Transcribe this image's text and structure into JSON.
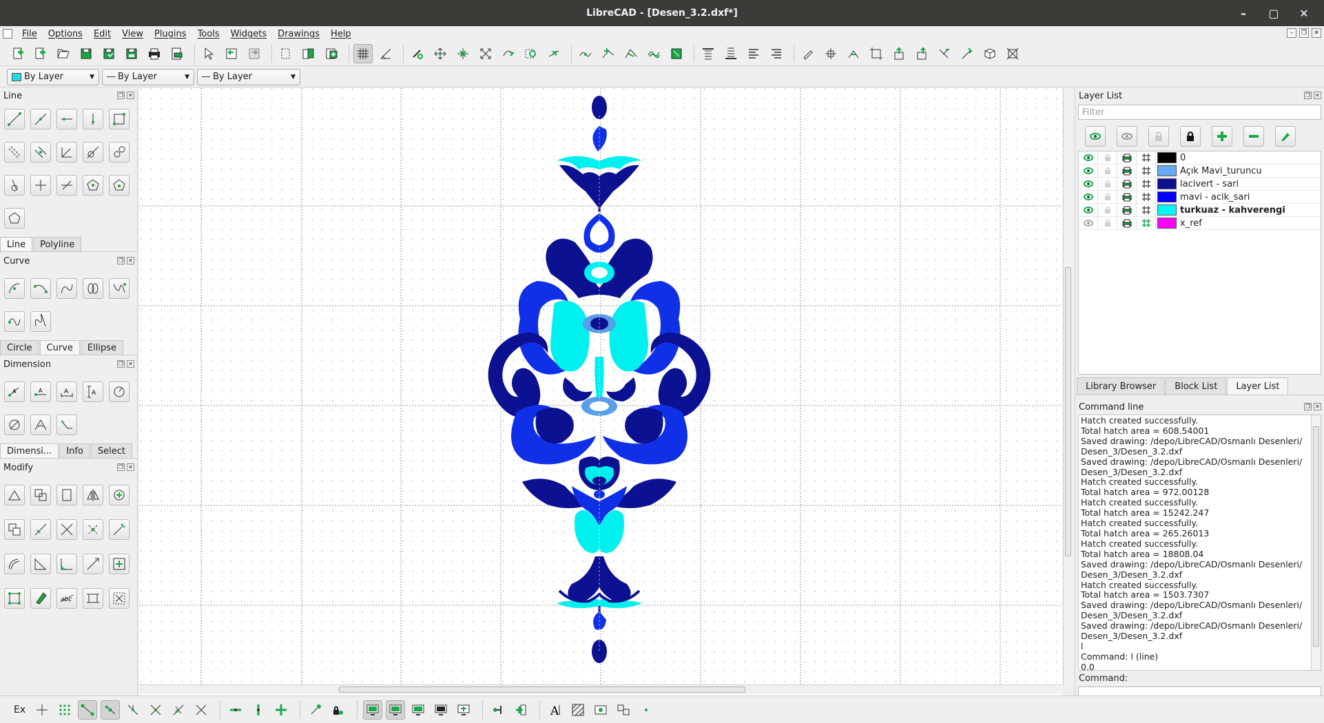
{
  "window": {
    "title": "LibreCAD - [Desen_3.2.dxf*]"
  },
  "menubar": [
    "File",
    "Options",
    "Edit",
    "View",
    "Plugins",
    "Tools",
    "Widgets",
    "Drawings",
    "Help"
  ],
  "properties": {
    "color": "By Layer",
    "linetype": "By Layer",
    "linewidth": "By Layer"
  },
  "left_panels": {
    "line": {
      "title": "Line",
      "tabs": [
        "Line",
        "Polyline"
      ]
    },
    "curve": {
      "title": "Curve",
      "tabs": [
        "Circle",
        "Curve",
        "Ellipse"
      ]
    },
    "dimension": {
      "title": "Dimension",
      "tabs": [
        "Dimensi...",
        "Info",
        "Select"
      ]
    },
    "modify": {
      "title": "Modify"
    }
  },
  "layer_list": {
    "title": "Layer List",
    "filter_placeholder": "Filter",
    "layers": [
      {
        "name": "0",
        "color": "#000000",
        "visible": true,
        "bold": false
      },
      {
        "name": "Açık Mavi_turuncu",
        "color": "#66aaf5",
        "visible": true,
        "bold": false
      },
      {
        "name": "lacivert - sari",
        "color": "#0b1190",
        "visible": true,
        "bold": false
      },
      {
        "name": "mavi - acik_sari",
        "color": "#0000ff",
        "visible": true,
        "bold": false
      },
      {
        "name": "turkuaz - kahverengi",
        "color": "#00f8f8",
        "visible": true,
        "bold": true
      },
      {
        "name": "x_ref",
        "color": "#ff00ff",
        "visible": false,
        "bold": false
      }
    ]
  },
  "right_tabs": [
    "Library Browser",
    "Block List",
    "Layer List"
  ],
  "command_line": {
    "title": "Command line",
    "lines": [
      "Hatch created successfully.",
      "Total hatch area =  608.54001",
      "Saved drawing: /depo/LibreCAD/Osmanlı Desenleri/",
      "Desen_3/Desen_3.2.dxf",
      "Saved drawing: /depo/LibreCAD/Osmanlı Desenleri/",
      "Desen_3/Desen_3.2.dxf",
      "Hatch created successfully.",
      "Total hatch area =  972.00128",
      "Hatch created successfully.",
      "Total hatch area =  15242.247",
      "Hatch created successfully.",
      "Total hatch area =  265.26013",
      "Hatch created successfully.",
      "Total hatch area =   18808.04",
      "Saved drawing: /depo/LibreCAD/Osmanlı Desenleri/",
      "Desen_3/Desen_3.2.dxf",
      "Hatch created successfully.",
      "Total hatch area =  1503.7307",
      "Saved drawing: /depo/LibreCAD/Osmanlı Desenleri/",
      "Desen_3/Desen_3.2.dxf",
      "Saved drawing: /depo/LibreCAD/Osmanlı Desenleri/",
      "Desen_3/Desen_3.2.dxf",
      "l",
      "Command: l (line)",
      "0,0"
    ],
    "input_label": "Command:"
  },
  "statusbar": {
    "snap_label": "Ex"
  },
  "colors": {
    "navy": "#0b1190",
    "blue": "#1030e8",
    "cyan": "#00f0f0",
    "light_blue": "#5a9ee6",
    "toolbar_green": "#1aa84a"
  }
}
